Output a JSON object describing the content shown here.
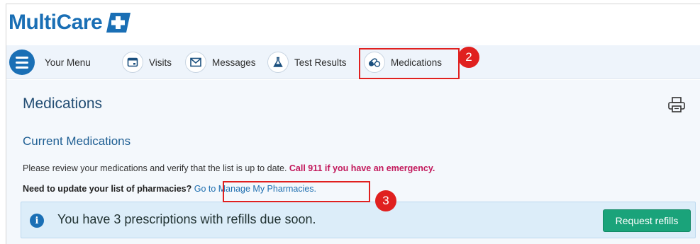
{
  "brand": {
    "name": "MultiCare",
    "color": "#1a6fb5"
  },
  "nav": {
    "menu_label": "Your Menu",
    "items": [
      {
        "label": "Visits",
        "icon": "calendar-icon"
      },
      {
        "label": "Messages",
        "icon": "envelope-icon"
      },
      {
        "label": "Test Results",
        "icon": "flask-icon"
      },
      {
        "label": "Medications",
        "icon": "pills-icon"
      }
    ]
  },
  "callouts": [
    "2",
    "3"
  ],
  "main": {
    "title": "Medications",
    "section_title": "Current Medications",
    "description": "Please review your medications and verify that the list is up to date. ",
    "emergency_text": "Call 911 if you have an emergency.",
    "pharmacy_question": "Need to update your list of pharmacies? ",
    "pharmacy_link": "Go to Manage My Pharmacies.",
    "alert_text": "You have 3 prescriptions with refills due soon.",
    "refill_button": "Request refills"
  },
  "colors": {
    "accent": "#1a6fb5",
    "emergency": "#c2185b",
    "button": "#1aa37a",
    "callout": "#e0201f"
  }
}
